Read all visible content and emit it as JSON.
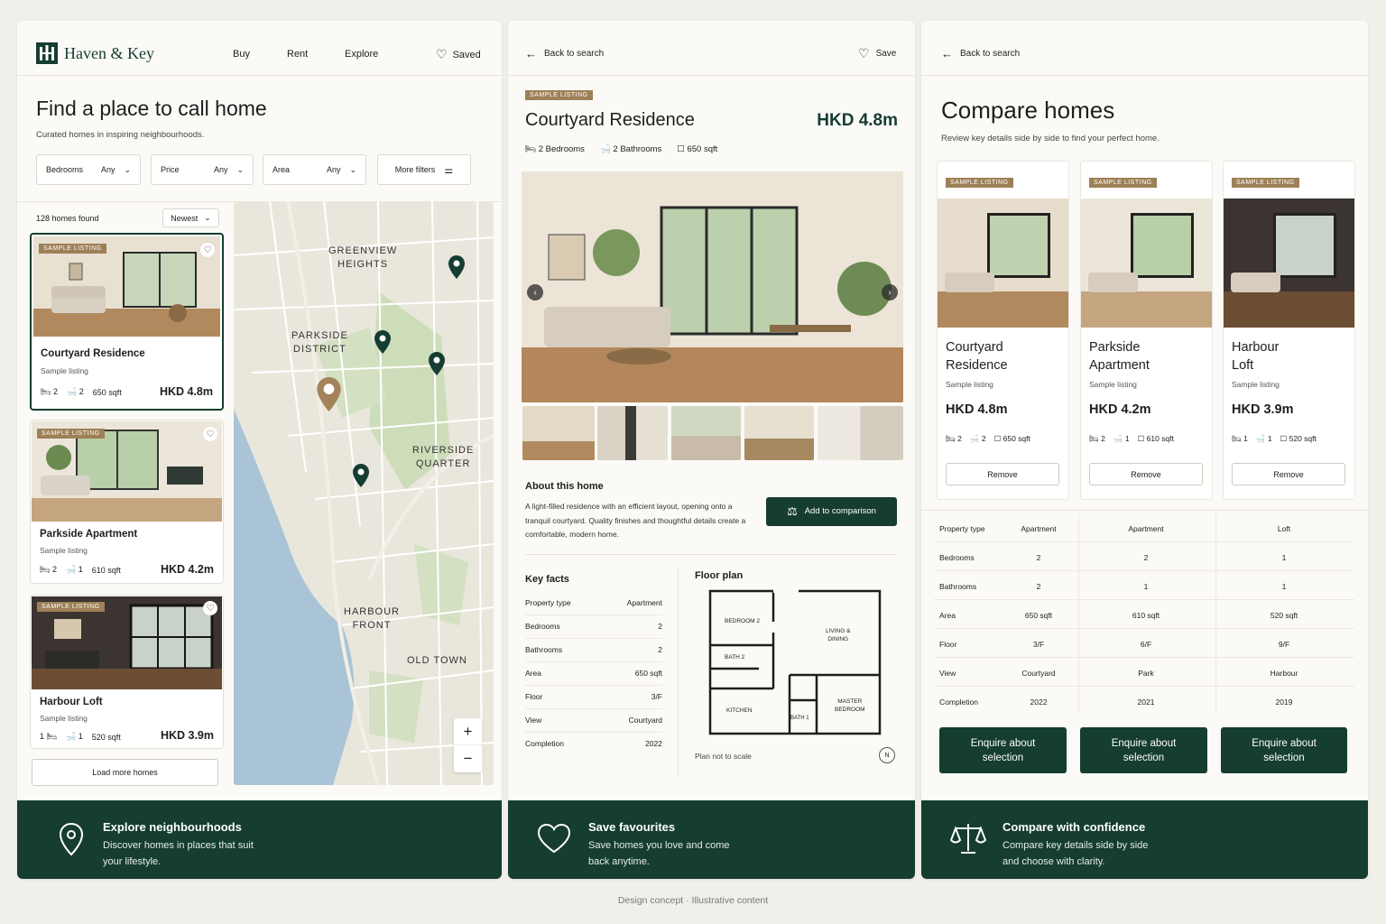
{
  "brand": {
    "name": "Haven & Key",
    "accent": "#153d30",
    "badge_color": "#9d8057"
  },
  "nav": {
    "buy": "Buy",
    "rent": "Rent",
    "explore": "Explore",
    "saved": "Saved"
  },
  "search": {
    "title": "Find a place to call home",
    "subtitle": "Curated homes in inspiring neighbourhoods.",
    "filters": [
      {
        "label": "Bedrooms",
        "value": "Any"
      },
      {
        "label": "Price",
        "value": "Any"
      },
      {
        "label": "Area",
        "value": "Any"
      }
    ],
    "more_filters": "More filters",
    "count": "128 homes found",
    "sort": "Newest",
    "load_more": "Load more homes"
  },
  "listings": [
    {
      "badge": "Sample listing",
      "title": "Courtyard Residence",
      "sub": "Sample listing",
      "beds": "2",
      "baths": "2",
      "area": "650 sqft",
      "price": "HKD 4.8m"
    },
    {
      "badge": "Sample listing",
      "title": "Parkside Apartment",
      "sub": "Sample listing",
      "beds": "2",
      "baths": "1",
      "area": "610 sqft",
      "price": "HKD 4.2m"
    },
    {
      "badge": "Sample listing",
      "title": "Harbour Loft",
      "sub": "Sample listing",
      "beds": "1",
      "baths": "1",
      "area": "520 sqft",
      "price": "HKD 3.9m"
    }
  ],
  "map": {
    "labels": [
      {
        "l1": "GREENVIEW",
        "l2": "HEIGHTS"
      },
      {
        "l1": "PARKSIDE",
        "l2": "DISTRICT"
      },
      {
        "l1": "RIVERSIDE",
        "l2": "QUARTER"
      },
      {
        "l1": "HARBOUR",
        "l2": "FRONT"
      },
      {
        "l1": "OLD TOWN",
        "l2": ""
      }
    ],
    "zoom_in": "+",
    "zoom_out": "−"
  },
  "detail": {
    "back": "Back to search",
    "save": "Save",
    "badge": "Sample listing",
    "title": "Courtyard Residence",
    "price": "HKD 4.8m",
    "beds": "2 Bedrooms",
    "baths": "2 Bathrooms",
    "area": "650 sqft",
    "about_title": "About this home",
    "about_text": "A light-filled residence with an efficient layout, opening onto a tranquil courtyard. Quality finishes and thoughtful details create a comfortable, modern home.",
    "add_compare": "Add to comparison",
    "key_facts_title": "Key facts",
    "key_facts": [
      {
        "k": "Property type",
        "v": "Apartment"
      },
      {
        "k": "Bedrooms",
        "v": "2"
      },
      {
        "k": "Bathrooms",
        "v": "2"
      },
      {
        "k": "Area",
        "v": "650 sqft"
      },
      {
        "k": "Floor",
        "v": "3/F"
      },
      {
        "k": "View",
        "v": "Courtyard"
      },
      {
        "k": "Completion",
        "v": "2022"
      }
    ],
    "floor_plan_title": "Floor plan",
    "plan_rooms": {
      "bed2": "BEDROOM 2",
      "living1": "LIVING &",
      "living2": "DINING",
      "bath2": "BATH 2",
      "kitchen": "KITCHEN",
      "bath1": "BATH 1",
      "master1": "MASTER",
      "master2": "BEDROOM"
    },
    "plan_note": "Plan not to scale",
    "north": "N"
  },
  "compare": {
    "back": "Back to search",
    "title": "Compare homes",
    "subtitle": "Review key details side by side to find your perfect home.",
    "homes": [
      {
        "badge": "Sample listing",
        "t1": "Courtyard",
        "t2": "Residence",
        "sub": "Sample listing",
        "price": "HKD 4.8m",
        "beds": "2",
        "baths": "2",
        "area": "650 sqft",
        "remove": "Remove"
      },
      {
        "badge": "Sample listing",
        "t1": "Parkside",
        "t2": "Apartment",
        "sub": "Sample listing",
        "price": "HKD 4.2m",
        "beds": "2",
        "baths": "1",
        "area": "610 sqft",
        "remove": "Remove"
      },
      {
        "badge": "Sample listing",
        "t1": "Harbour",
        "t2": "Loft",
        "sub": "Sample listing",
        "price": "HKD 3.9m",
        "beds": "1",
        "baths": "1",
        "area": "520 sqft",
        "remove": "Remove"
      }
    ],
    "rows": [
      {
        "k": "Property type",
        "a": "Apartment",
        "b": "Apartment",
        "c": "Loft"
      },
      {
        "k": "Bedrooms",
        "a": "2",
        "b": "2",
        "c": "1"
      },
      {
        "k": "Bathrooms",
        "a": "2",
        "b": "1",
        "c": "1"
      },
      {
        "k": "Area",
        "a": "650 sqft",
        "b": "610 sqft",
        "c": "520 sqft"
      },
      {
        "k": "Floor",
        "a": "3/F",
        "b": "6/F",
        "c": "9/F"
      },
      {
        "k": "View",
        "a": "Courtyard",
        "b": "Park",
        "c": "Harbour"
      },
      {
        "k": "Completion",
        "a": "2022",
        "b": "2021",
        "c": "2019"
      }
    ],
    "enquire": "Enquire about selection"
  },
  "features": [
    {
      "title": "Explore neighbourhoods",
      "l1": "Discover homes in places that suit",
      "l2": "your lifestyle."
    },
    {
      "title": "Save favourites",
      "l1": "Save homes you love and come",
      "l2": "back anytime."
    },
    {
      "title": "Compare with confidence",
      "l1": "Compare key details side by side",
      "l2": "and choose with clarity."
    }
  ],
  "footer": "Design concept · Illustrative content"
}
